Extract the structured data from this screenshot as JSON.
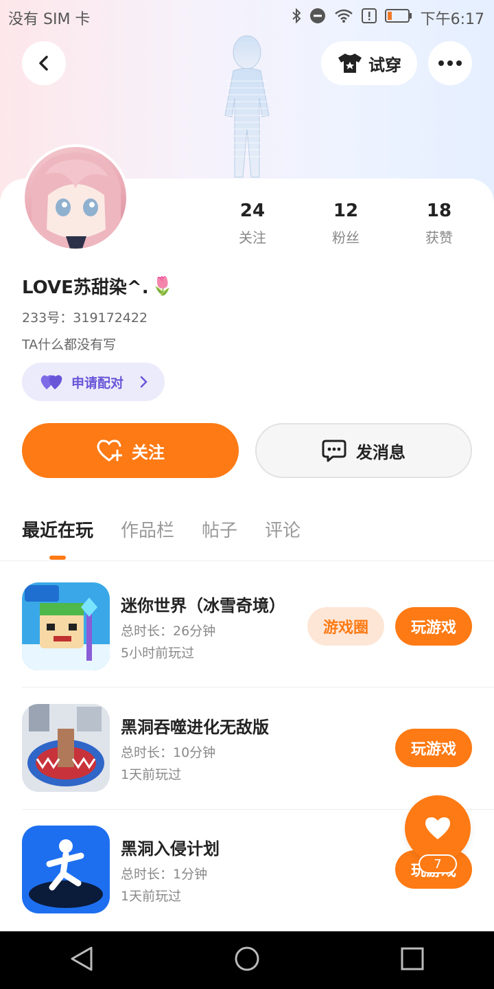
{
  "status_bar": {
    "carrier": "没有 SIM 卡",
    "time": "下午6:17"
  },
  "header": {
    "try_label": "试穿"
  },
  "profile": {
    "name": "LOVE苏甜染^.",
    "name_emoji": "🌷",
    "uid": "233号：319172422",
    "bio": "TA什么都没有写",
    "pair_label": "申请配对"
  },
  "stats": [
    {
      "value": "24",
      "label": "关注"
    },
    {
      "value": "12",
      "label": "粉丝"
    },
    {
      "value": "18",
      "label": "获赞"
    }
  ],
  "actions": {
    "follow_label": "关注",
    "message_label": "发消息"
  },
  "tabs": [
    {
      "label": "最近在玩",
      "active": true
    },
    {
      "label": "作品栏",
      "active": false
    },
    {
      "label": "帖子",
      "active": false
    },
    {
      "label": "评论",
      "active": false
    }
  ],
  "games": [
    {
      "title": "迷你世界（冰雪奇境）",
      "duration": "总时长：26分钟",
      "last_played": "5小时前玩过",
      "has_circle": true,
      "circle_label": "游戏圈",
      "play_label": "玩游戏"
    },
    {
      "title": "黑洞吞噬进化无敌版",
      "duration": "总时长：10分钟",
      "last_played": "1天前玩过",
      "has_circle": false,
      "play_label": "玩游戏"
    },
    {
      "title": "黑洞入侵计划",
      "duration": "总时长：1分钟",
      "last_played": "1天前玩过",
      "has_circle": false,
      "play_label": "玩游戏"
    }
  ],
  "float_like": {
    "count": "7"
  },
  "colors": {
    "accent": "#fd7a14",
    "pair": "#6756d8"
  }
}
